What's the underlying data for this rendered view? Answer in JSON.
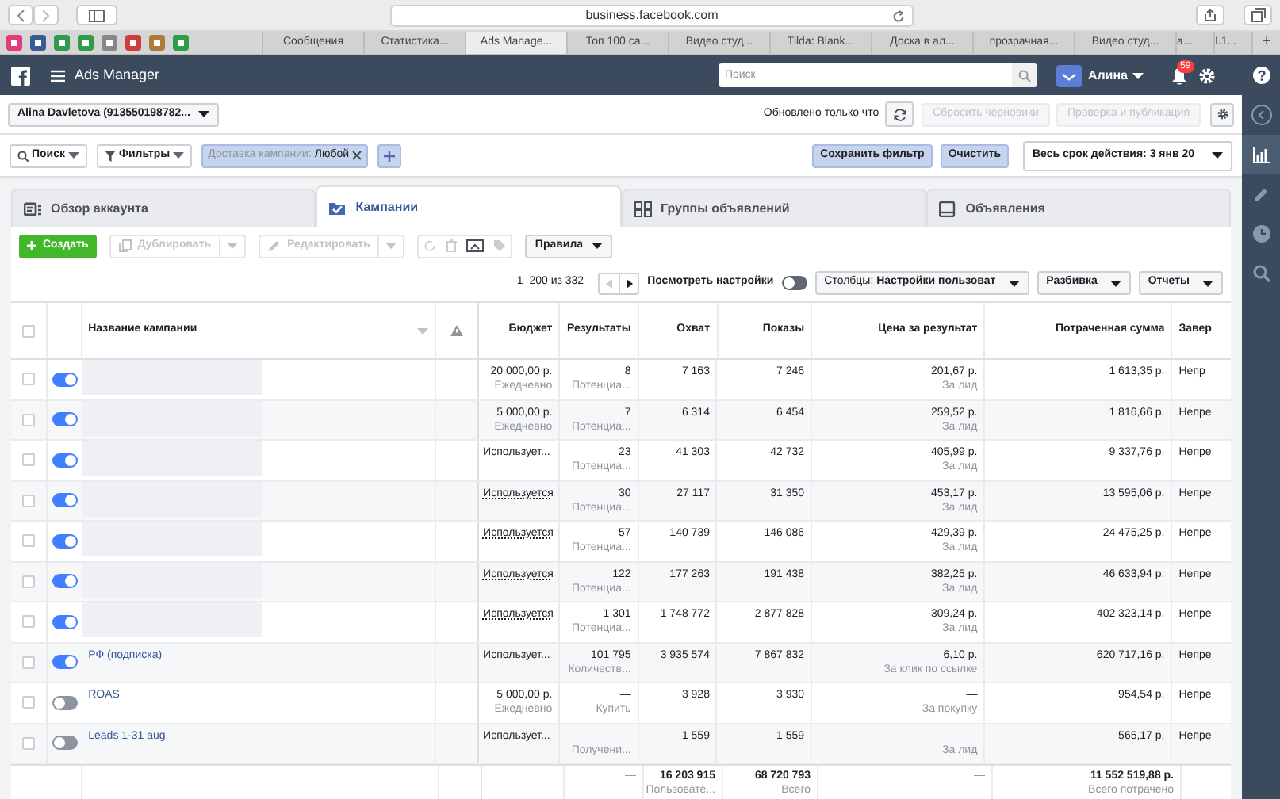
{
  "browser": {
    "url": "business.facebook.com",
    "tabs": [
      {
        "label": "Сообщения",
        "selected": false
      },
      {
        "label": "Статистика...",
        "selected": false
      },
      {
        "label": "Ads Manage...",
        "selected": true
      },
      {
        "label": "Топ 100 са...",
        "selected": false
      },
      {
        "label": "Видео студ...",
        "selected": false
      },
      {
        "label": "Tilda: Blank...",
        "selected": false
      },
      {
        "label": "Доска в ал...",
        "selected": false
      },
      {
        "label": "прозрачная...",
        "selected": false
      },
      {
        "label": "Видео студ...",
        "selected": false
      },
      {
        "label": "а...",
        "selected": false
      },
      {
        "label": "І.1...",
        "selected": false
      }
    ],
    "new_tab": "+"
  },
  "header": {
    "title": "Ads Manager",
    "search_placeholder": "Поиск",
    "user": "Алина",
    "notifications": "59"
  },
  "toolbar": {
    "account": "Alina Davletova (913550198782...",
    "status": "Обновлено только что",
    "buttons": [
      {
        "label": "Сбросить черновики",
        "disabled": true
      },
      {
        "label": "Проверка и публикация",
        "disabled": true
      }
    ]
  },
  "filters": {
    "search": "Поиск",
    "filters": "Фильтры",
    "chip_label": "Доставка кампании:",
    "chip_value": "Любой",
    "save": "Сохранить фильтр",
    "clear": "Очистить",
    "date": "Весь срок действия: 3 янв 20"
  },
  "tabs": [
    {
      "label": "Обзор аккаунта",
      "selected": false
    },
    {
      "label": "Кампании",
      "selected": true
    },
    {
      "label": "Группы объявлений",
      "selected": false
    },
    {
      "label": "Объявления",
      "selected": false
    }
  ],
  "actions": {
    "create": "Создать",
    "duplicate": {
      "label": "Дублировать",
      "disabled": true
    },
    "edit": {
      "label": "Редактировать",
      "disabled": true
    },
    "rules": "Правила"
  },
  "pagination": {
    "range": "1–200 из 332",
    "view_settings": {
      "label": "Посмотреть настройки",
      "on": false
    },
    "columns_label": "Столбцы:",
    "columns_value": "Настройки пользоват",
    "breakdown": "Разбивка",
    "reports": "Отчеты"
  },
  "table": {
    "select_all_checked": false,
    "columns": [
      "Название кампании",
      "Бюджет",
      "Результаты",
      "Охват",
      "Показы",
      "Цена за результат",
      "Потраченная сумма",
      "Завер"
    ],
    "rows": [
      {
        "checked": false,
        "on": true,
        "name_hidden": true,
        "budget": "20 000,00 р.",
        "budget_note": "Ежедневно",
        "budget_link": false,
        "results": "8",
        "results_note": "Потенциа...",
        "reach": "7 163",
        "impressions": "7 246",
        "price": "201,67 р.",
        "price_note": "За лид",
        "spent": "1 613,35 р.",
        "end": "Непр"
      },
      {
        "checked": false,
        "on": true,
        "name_hidden": true,
        "budget": "5 000,00 р.",
        "budget_note": "Ежедневно",
        "budget_link": false,
        "results": "7",
        "results_note": "Потенциа...",
        "reach": "6 314",
        "impressions": "6 454",
        "price": "259,52 р.",
        "price_note": "За лид",
        "spent": "1 816,66 р.",
        "end": "Непре"
      },
      {
        "checked": false,
        "on": true,
        "name_hidden": true,
        "budget": "Использует...",
        "budget_link": false,
        "results": "23",
        "results_note": "Потенциа...",
        "reach": "41 303",
        "impressions": "42 732",
        "price": "405,99 р.",
        "price_note": "За лид",
        "spent": "9 337,76 р.",
        "end": "Непре"
      },
      {
        "checked": false,
        "on": true,
        "name_hidden": true,
        "budget": "Используется",
        "budget_link": true,
        "results": "30",
        "results_note": "Потенциа...",
        "reach": "27 117",
        "impressions": "31 350",
        "price": "453,17 р.",
        "price_note": "За лид",
        "spent": "13 595,06 р.",
        "end": "Непре"
      },
      {
        "checked": false,
        "on": true,
        "name_hidden": true,
        "budget": "Используется",
        "budget_link": true,
        "results": "57",
        "results_note": "Потенциа...",
        "reach": "140 739",
        "impressions": "146 086",
        "price": "429,39 р.",
        "price_note": "За лид",
        "spent": "24 475,25 р.",
        "end": "Непре"
      },
      {
        "checked": false,
        "on": true,
        "name_hidden": true,
        "budget": "Используется",
        "budget_link": true,
        "results": "122",
        "results_note": "Потенциа...",
        "reach": "177 263",
        "impressions": "191 438",
        "price": "382,25 р.",
        "price_note": "За лид",
        "spent": "46 633,94 р.",
        "end": "Непре"
      },
      {
        "checked": false,
        "on": true,
        "name_hidden": true,
        "budget": "Используется",
        "budget_link": true,
        "results": "1 301",
        "results_note": "Потенциа...",
        "reach": "1 748 772",
        "impressions": "2 877 828",
        "price": "309,24 р.",
        "price_note": "За лид",
        "spent": "402 323,14 р.",
        "end": "Непре"
      },
      {
        "checked": false,
        "on": true,
        "name": "РФ (подписка)",
        "budget": "Использует...",
        "budget_link": false,
        "results": "101 795",
        "results_note": "Количеств...",
        "reach": "3 935 574",
        "impressions": "7 867 832",
        "price": "6,10 р.",
        "price_note": "За клик по ссылке",
        "spent": "620 717,16 р.",
        "end": "Непре"
      },
      {
        "checked": false,
        "on": false,
        "name": "ROAS",
        "budget": "5 000,00 р.",
        "budget_note": "Ежедневно",
        "budget_link": false,
        "results": "—",
        "results_note": "Купить",
        "reach": "3 928",
        "impressions": "3 930",
        "price": "—",
        "price_note": "За покупку",
        "spent": "954,54 р.",
        "end": "Непре"
      },
      {
        "checked": false,
        "on": false,
        "name": "Leads 1-31 aug",
        "budget": "Использует...",
        "budget_link": false,
        "results": "—",
        "results_note": "Получени...",
        "reach": "1 559",
        "impressions": "1 559",
        "price": "—",
        "price_note": "За лид",
        "spent": "565,17 р.",
        "end": "Непре"
      }
    ],
    "totals": {
      "results": "—",
      "reach": "16 203 915",
      "reach_note": "Пользовате...",
      "impressions": "68 720 793",
      "impressions_note": "Всего",
      "price": "—",
      "spent": "11 552 519,88 р.",
      "spent_note": "Всего потрачено"
    }
  }
}
